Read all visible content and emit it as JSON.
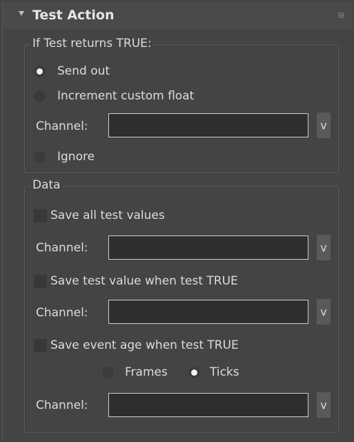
{
  "rollout": {
    "title": "Test Action"
  },
  "test_true_group": {
    "title": "If Test returns TRUE:",
    "options": [
      {
        "label": "Send out",
        "selected": true
      },
      {
        "label": "Increment custom float",
        "selected": false
      },
      {
        "label": "Ignore",
        "selected": false
      }
    ],
    "channel_label": "Channel:",
    "channel_value": "",
    "channel_button": "v"
  },
  "data_group": {
    "title": "Data",
    "save_all": {
      "label": "Save all test values",
      "checked": false
    },
    "save_all_channel": {
      "label": "Channel:",
      "value": "",
      "button": "v"
    },
    "save_true": {
      "label": "Save test value when test TRUE",
      "checked": false
    },
    "save_true_channel": {
      "label": "Channel:",
      "value": "",
      "button": "v"
    },
    "save_age": {
      "label": "Save event age when test TRUE",
      "checked": false
    },
    "age_units": [
      {
        "label": "Frames",
        "selected": false
      },
      {
        "label": "Ticks",
        "selected": true
      }
    ],
    "save_age_channel": {
      "label": "Channel:",
      "value": "",
      "button": "v"
    }
  }
}
